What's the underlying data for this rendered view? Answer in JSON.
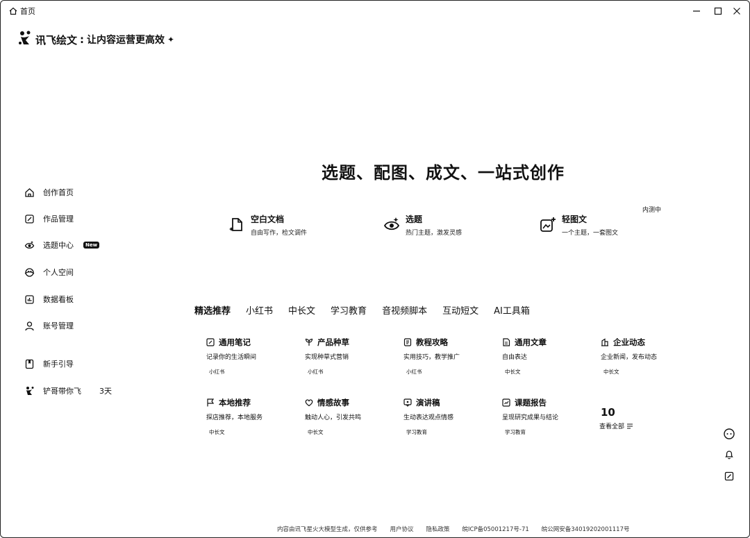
{
  "window": {
    "title": "首页",
    "home_icon": "home-icon",
    "controls": [
      "minimize",
      "maximize",
      "close"
    ]
  },
  "brand": {
    "name": "讯飞绘文",
    "separator": ":",
    "slogan": "让内容运营更高效",
    "sparkle": "✦"
  },
  "sidebar": {
    "items": [
      {
        "label": "创作首页",
        "icon": "home-icon"
      },
      {
        "label": "作品管理",
        "icon": "edit-icon"
      },
      {
        "label": "选题中心",
        "icon": "eye-icon",
        "badge": "New"
      },
      {
        "label": "个人空间",
        "icon": "space-icon"
      },
      {
        "label": "数据看板",
        "icon": "chart-icon"
      },
      {
        "label": "账号管理",
        "icon": "user-icon"
      },
      {
        "label": "新手引导",
        "icon": "book-icon"
      }
    ],
    "promo": {
      "label": "铲哥带你飞",
      "days": "3天"
    }
  },
  "hero": {
    "title": "选题、配图、成文、一站式创作"
  },
  "actions": [
    {
      "title": "空白文档",
      "subtitle": "自由写作，检文调件",
      "icon": "doc-sparkle-icon"
    },
    {
      "title": "选题",
      "subtitle": "热门主题，激发灵感",
      "icon": "eye-sparkle-icon"
    },
    {
      "title": "轻图文",
      "subtitle": "一个主题，一套图文",
      "icon": "image-plus-icon"
    }
  ],
  "beta_label": "内测中",
  "tabs": [
    "精选推荐",
    "小红书",
    "中长文",
    "学习教育",
    "音视频脚本",
    "互动短文",
    "AI工具箱"
  ],
  "active_tab": 0,
  "templates": [
    {
      "title": "通用笔记",
      "desc": "记录你的生活瞬间",
      "tag": "小红书",
      "icon": "note-icon"
    },
    {
      "title": "产品种草",
      "desc": "实现种草式营销",
      "tag": "小红书",
      "icon": "sprout-icon"
    },
    {
      "title": "教程攻略",
      "desc": "实用技巧，教学推广",
      "tag": "小红书",
      "icon": "guide-icon"
    },
    {
      "title": "通用文章",
      "desc": "自由表达",
      "tag": "中长文",
      "icon": "article-icon"
    },
    {
      "title": "企业动态",
      "desc": "企业新闻，发布动态",
      "tag": "中长文",
      "icon": "company-icon"
    },
    {
      "title": "本地推荐",
      "desc": "探店推荐，本地服务",
      "tag": "中长文",
      "icon": "flag-icon"
    },
    {
      "title": "情感故事",
      "desc": "触动人心，引发共鸣",
      "tag": "中长文",
      "icon": "heart-icon"
    },
    {
      "title": "演讲稿",
      "desc": "生动表达观点情感",
      "tag": "学习教育",
      "icon": "speech-icon"
    },
    {
      "title": "课题报告",
      "desc": "呈现研究成果与结论",
      "tag": "学习教育",
      "icon": "report-icon"
    }
  ],
  "more": {
    "count": "10",
    "label": "查看全部"
  },
  "floating": [
    {
      "name": "assistant-icon"
    },
    {
      "name": "bell-icon"
    },
    {
      "name": "feedback-icon"
    }
  ],
  "footer": [
    "内容由讯飞星火大模型生成，仅供参考",
    "用户协议",
    "隐私政策",
    "皖ICP备05001217号-71",
    "皖公网安备34019202001117号"
  ]
}
